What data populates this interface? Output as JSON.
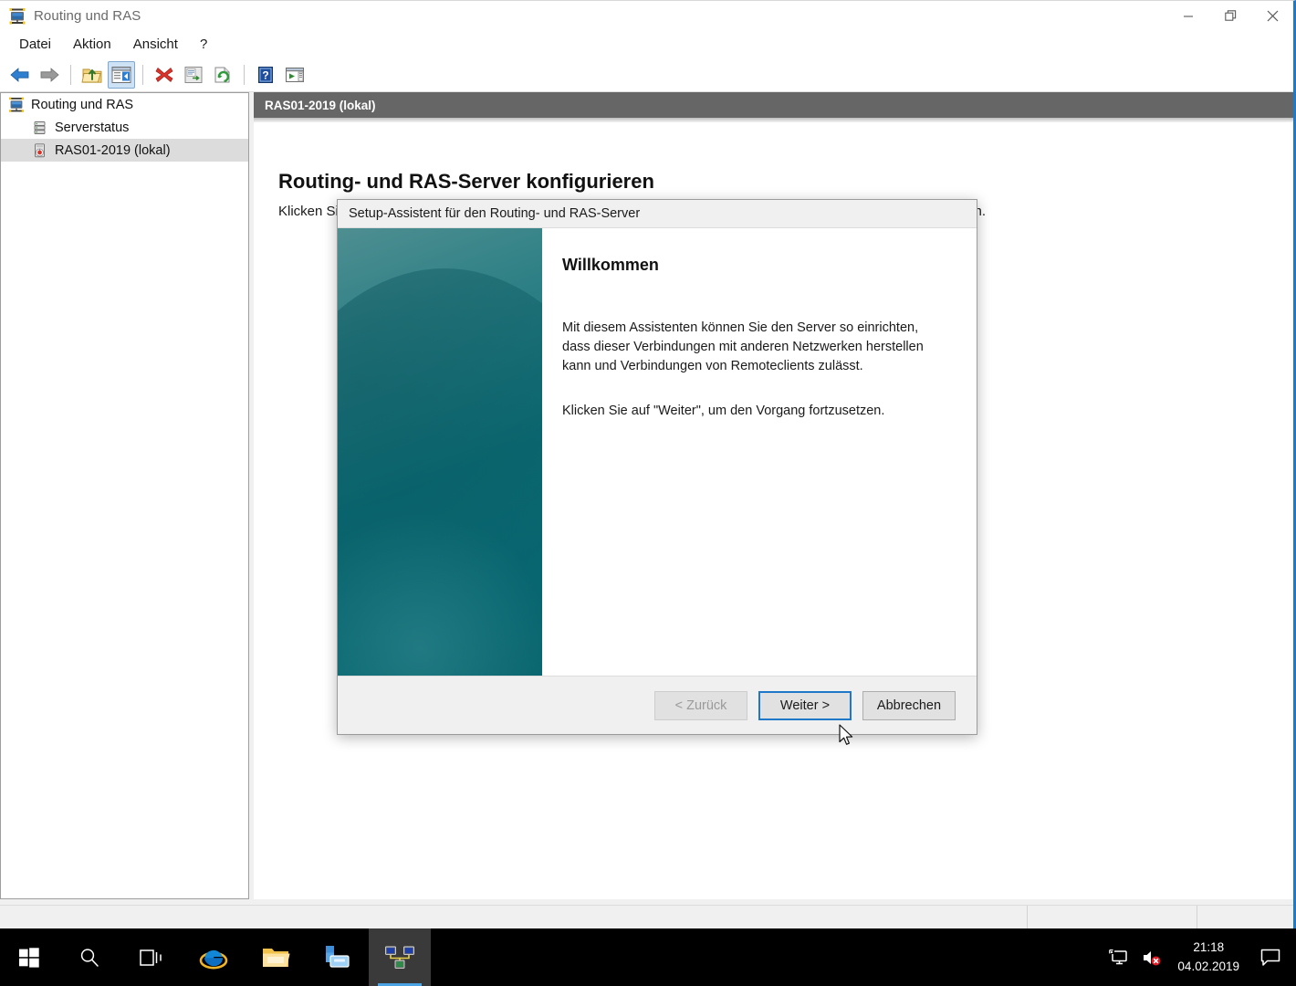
{
  "window": {
    "title": "Routing und RAS",
    "app_icon": "routing-ras-icon",
    "minimize_label": "—",
    "restore_label": "❐",
    "close_label": "✕"
  },
  "menubar": {
    "items": [
      {
        "label": "Datei",
        "name": "menu-datei"
      },
      {
        "label": "Aktion",
        "name": "menu-aktion"
      },
      {
        "label": "Ansicht",
        "name": "menu-ansicht"
      },
      {
        "label": "?",
        "name": "menu-hilfe"
      }
    ]
  },
  "toolbar": {
    "buttons": [
      {
        "name": "back-icon",
        "title": "Zurück"
      },
      {
        "name": "forward-icon",
        "title": "Vorwärts"
      },
      {
        "name": "up-folder-icon",
        "title": "Eine Ebene höher"
      },
      {
        "name": "show-hide-tree-icon",
        "title": "Konsolenstruktur ein-/ausblenden",
        "pressed": true
      },
      {
        "name": "delete-icon",
        "title": "Löschen"
      },
      {
        "name": "properties-icon",
        "title": "Eigenschaften"
      },
      {
        "name": "refresh-icon",
        "title": "Aktualisieren"
      },
      {
        "name": "help-icon",
        "title": "Hilfe"
      },
      {
        "name": "export-list-icon",
        "title": "Liste exportieren"
      }
    ]
  },
  "tree": {
    "nodes": [
      {
        "label": "Routing und RAS",
        "icon": "routing-ras-root-icon",
        "level": 0,
        "selected": false
      },
      {
        "label": "Serverstatus",
        "icon": "server-status-icon",
        "level": 1,
        "selected": false
      },
      {
        "label": "RAS01-2019 (lokal)",
        "icon": "ras-server-icon",
        "level": 1,
        "selected": true
      }
    ]
  },
  "content": {
    "header": "RAS01-2019 (lokal)",
    "title": "Routing- und RAS-Server konfigurieren",
    "description": "Klicken Sie im Menü \"Aktion\" auf \"Routing und RAS konfigurieren und aktivieren\", um Routing und RAS einzurichten."
  },
  "wizard": {
    "title": "Setup-Assistent für den Routing- und RAS-Server",
    "heading": "Willkommen",
    "paragraph1": "Mit diesem Assistenten können Sie den Server so einrichten, dass dieser Verbindungen mit anderen Netzwerken herstellen kann und Verbindungen von Remoteclients zulässt.",
    "paragraph2": "Klicken Sie auf \"Weiter\", um den Vorgang fortzusetzen.",
    "buttons": {
      "back": "< Zurück",
      "next": "Weiter >",
      "cancel": "Abbrechen"
    },
    "banner_color": "#0e7078"
  },
  "statusbar": {
    "segment1": "",
    "segment2": "",
    "segment3": ""
  },
  "taskbar": {
    "items": [
      {
        "name": "start-button",
        "icon": "windows-logo-icon",
        "label": "Start",
        "active": false,
        "running": false
      },
      {
        "name": "search-button",
        "icon": "search-icon",
        "label": "Suchen",
        "active": false,
        "running": false
      },
      {
        "name": "task-view-button",
        "icon": "task-view-icon",
        "label": "Taskansicht",
        "active": false,
        "running": false
      },
      {
        "name": "internet-explorer-button",
        "icon": "internet-explorer-icon",
        "label": "Internet Explorer",
        "active": false,
        "running": false
      },
      {
        "name": "file-explorer-button",
        "icon": "file-explorer-icon",
        "label": "Explorer",
        "active": false,
        "running": false
      },
      {
        "name": "server-manager-button",
        "icon": "server-manager-icon",
        "label": "Server-Manager",
        "active": false,
        "running": true
      },
      {
        "name": "routing-ras-button",
        "icon": "routing-ras-taskbar-icon",
        "label": "Routing und RAS",
        "active": true,
        "running": true
      }
    ],
    "tray": {
      "network_icon": "network-icon",
      "volume_icon": "volume-muted-icon",
      "time": "21:18",
      "date": "04.02.2019",
      "action_center_icon": "action-center-icon"
    },
    "accent_color": "#4ba3e3"
  }
}
